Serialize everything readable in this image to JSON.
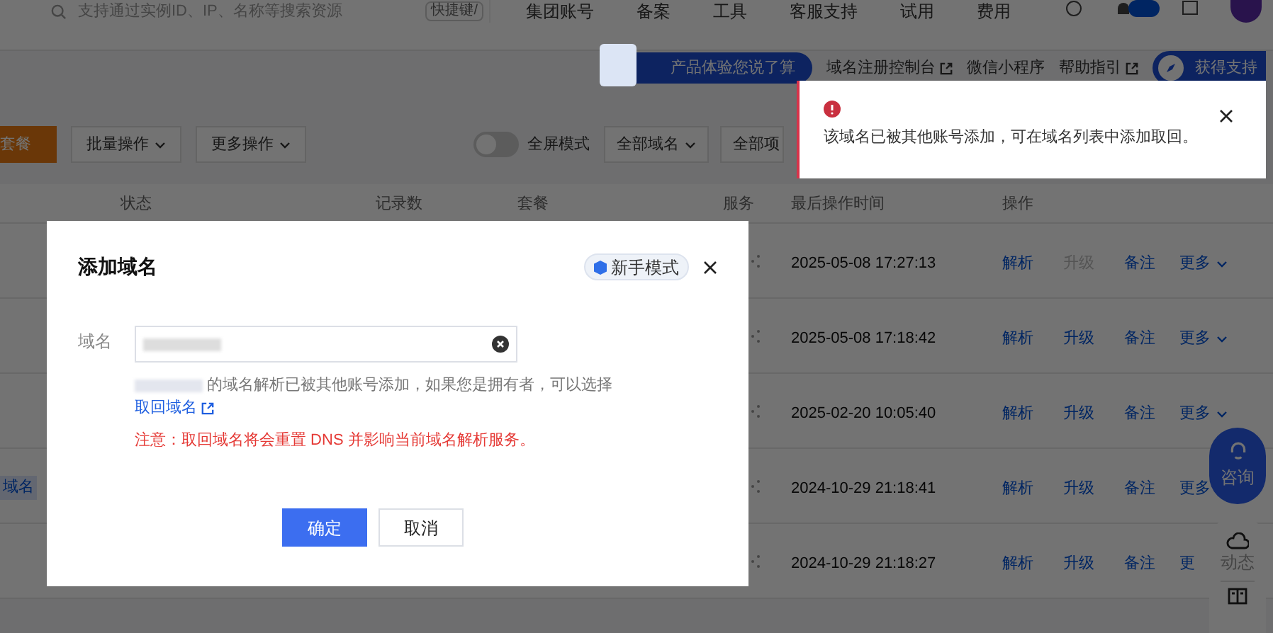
{
  "top_nav": {
    "search": {
      "placeholder": "支持通过实例ID、IP、名称等搜索资源",
      "shortcut": "快捷键/"
    },
    "items": [
      "集团账号",
      "备案",
      "工具",
      "客服支持",
      "试用",
      "费用"
    ]
  },
  "sub_nav": {
    "banner": "产品体验您说了算",
    "links": [
      {
        "label": "域名注册控制台",
        "external": true
      },
      {
        "label": "微信小程序",
        "external": false
      },
      {
        "label": "帮助指引",
        "external": true
      }
    ],
    "support_button": "获得支持"
  },
  "toolbar": {
    "primary_button": "套餐",
    "dropdowns": [
      "批量操作",
      "更多操作"
    ],
    "fullscreen_toggle": {
      "label": "全屏模式",
      "on": false
    },
    "filters": [
      "全部域名",
      "全部项"
    ]
  },
  "table": {
    "columns": [
      "状态",
      "记录数",
      "套餐",
      "服务",
      "最后操作时间",
      "操作"
    ],
    "rows": [
      {
        "tag": "",
        "time": "2025-05-08 17:27:13",
        "actions": [
          {
            "label": "解析",
            "disabled": false
          },
          {
            "label": "升级",
            "disabled": true
          },
          {
            "label": "备注",
            "disabled": false
          },
          {
            "label": "更多",
            "disabled": false,
            "menu": true
          }
        ]
      },
      {
        "tag": "",
        "time": "2025-05-08 17:18:42",
        "actions": [
          {
            "label": "解析",
            "disabled": false
          },
          {
            "label": "升级",
            "disabled": false
          },
          {
            "label": "备注",
            "disabled": false
          },
          {
            "label": "更多",
            "disabled": false,
            "menu": true
          }
        ]
      },
      {
        "tag": "",
        "time": "2025-02-20 10:05:40",
        "actions": [
          {
            "label": "解析",
            "disabled": false
          },
          {
            "label": "升级",
            "disabled": false
          },
          {
            "label": "备注",
            "disabled": false
          },
          {
            "label": "更多",
            "disabled": false,
            "menu": true
          }
        ]
      },
      {
        "tag": "域名",
        "time": "2024-10-29 21:18:41",
        "actions": [
          {
            "label": "解析",
            "disabled": false
          },
          {
            "label": "升级",
            "disabled": false
          },
          {
            "label": "备注",
            "disabled": false
          },
          {
            "label": "更多",
            "disabled": false,
            "menu": false
          }
        ]
      },
      {
        "tag": "",
        "time": "2024-10-29 21:18:27",
        "actions": [
          {
            "label": "解析",
            "disabled": false
          },
          {
            "label": "升级",
            "disabled": false
          },
          {
            "label": "备注",
            "disabled": false
          },
          {
            "label": "更",
            "disabled": false,
            "menu": false
          }
        ]
      }
    ]
  },
  "float_buttons": [
    {
      "kind": "primary",
      "label": "咨询"
    },
    {
      "kind": "plain",
      "label": "动态"
    }
  ],
  "dialog": {
    "title": "添加域名",
    "mode_badge": "新手模式",
    "field_label": "域名",
    "message": "的域名解析已被其他账号添加，如果您是拥有者，可以选择",
    "reclaim_link": "取回域名",
    "warning": "注意：取回域名将会重置 DNS 并影响当前域名解析服务。",
    "buttons": [
      {
        "label": "确定",
        "primary": true
      },
      {
        "label": "取消",
        "primary": false
      }
    ]
  },
  "toast": {
    "message": "该域名已被其他账号添加，可在域名列表中添加取回。"
  }
}
